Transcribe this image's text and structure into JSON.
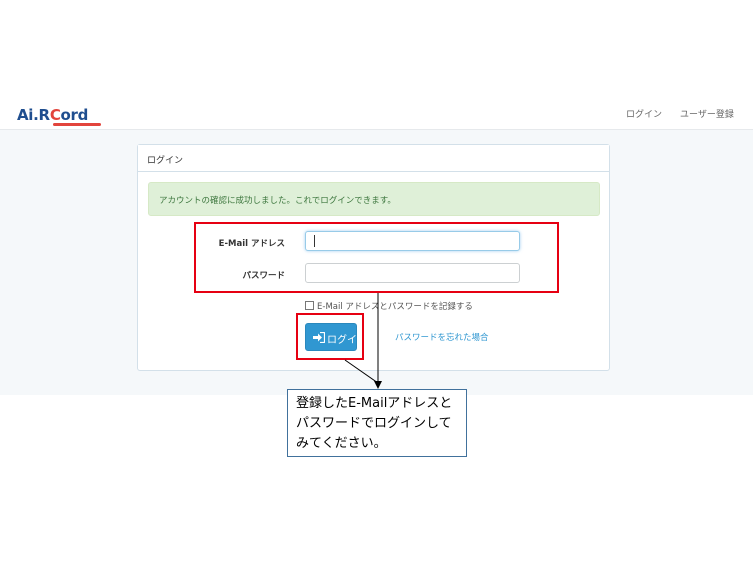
{
  "brand": {
    "name_part1": "Ai.R",
    "name_ring": "C",
    "name_part2": "ord",
    "accent_color": "#e2443c",
    "brand_color": "#1f4e8f"
  },
  "navbar": {
    "login_label": "ログイン",
    "register_label": "ユーザー登録"
  },
  "panel": {
    "title": "ログイン",
    "alert_text": "アカウントの確認に成功しました。これでログインできます。",
    "email_label": "E-Mail アドレス",
    "email_value": "",
    "password_label": "パスワード",
    "password_value": "",
    "remember_label": "E-Mail アドレスとパスワードを記録する",
    "remember_checked": false,
    "login_button_label": "ログイン",
    "login_button_icon": "sign-in-icon",
    "forgot_link": "パスワードを忘れた場合"
  },
  "annotation": {
    "callout_text": "登録したE-Mailアドレスとパスワードでログインしてみてください。",
    "highlight_color": "#e60012"
  },
  "colors": {
    "primary": "#3097d1",
    "alert_bg": "#dff0d8",
    "alert_text": "#3c763d",
    "page_bg": "#f5f8fa"
  }
}
